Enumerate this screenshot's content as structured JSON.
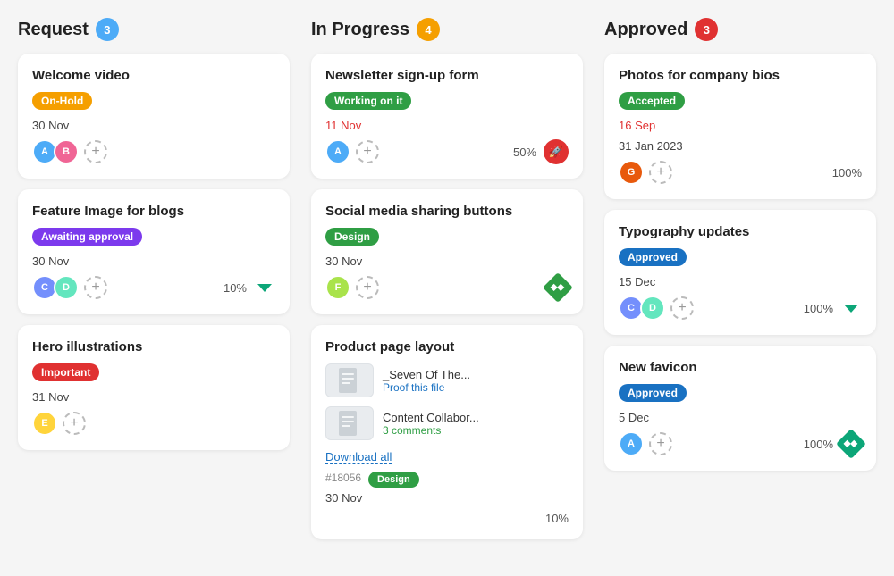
{
  "columns": [
    {
      "id": "request",
      "title": "Request",
      "badge": "3",
      "badge_color": "badge-blue",
      "cards": [
        {
          "id": "welcome-video",
          "title": "Welcome video",
          "tag": "On-Hold",
          "tag_color": "tag-orange",
          "date": "30 Nov",
          "date_red": false,
          "avatars": [
            "av1",
            "av2"
          ],
          "show_add": true,
          "percent": null,
          "icon": null
        },
        {
          "id": "feature-image",
          "title": "Feature Image for blogs",
          "tag": "Awaiting approval",
          "tag_color": "tag-purple",
          "date": "30 Nov",
          "date_red": false,
          "avatars": [
            "av3",
            "av4"
          ],
          "show_add": true,
          "percent": "10%",
          "icon": "chevron-down"
        },
        {
          "id": "hero-illustrations",
          "title": "Hero illustrations",
          "tag": "Important",
          "tag_color": "tag-red",
          "date": "31 Nov",
          "date_red": false,
          "avatars": [
            "av5"
          ],
          "show_add": true,
          "percent": null,
          "icon": null
        }
      ]
    },
    {
      "id": "in-progress",
      "title": "In Progress",
      "badge": "4",
      "badge_color": "badge-orange",
      "cards": [
        {
          "id": "newsletter-form",
          "title": "Newsletter sign-up form",
          "tag": "Working on it",
          "tag_color": "tag-working",
          "date": "11 Nov",
          "date_red": true,
          "avatars": [
            "av1"
          ],
          "show_add": true,
          "percent": "50%",
          "icon": "rocket",
          "type": "standard"
        },
        {
          "id": "social-media",
          "title": "Social media sharing buttons",
          "tag": "Design",
          "tag_color": "tag-design",
          "date": "30 Nov",
          "date_red": false,
          "avatars": [
            "av6"
          ],
          "show_add": true,
          "percent": null,
          "icon": "diamond-green",
          "type": "standard"
        },
        {
          "id": "product-page",
          "title": "Product page layout",
          "tag": null,
          "tag_color": null,
          "date": "30 Nov",
          "date_red": false,
          "avatars": [],
          "show_add": false,
          "percent": "10%",
          "icon": null,
          "type": "files",
          "files": [
            {
              "name": "_Seven Of The...",
              "link": "Proof this file",
              "link_color": "file-link"
            },
            {
              "name": "Content Collabor...",
              "link": "3 comments",
              "link_color": "file-link-green"
            }
          ],
          "download": "Download all",
          "ticket": "#18056",
          "ticket_tag": "Design"
        }
      ]
    },
    {
      "id": "approved",
      "title": "Approved",
      "badge": "3",
      "badge_color": "badge-red",
      "cards": [
        {
          "id": "photos-bios",
          "title": "Photos for company bios",
          "tag": "Accepted",
          "tag_color": "tag-green",
          "date": "16 Sep",
          "date_red": true,
          "date2": "31 Jan 2023",
          "avatars": [
            "av7"
          ],
          "show_add": true,
          "percent": "100%",
          "icon": null
        },
        {
          "id": "typography",
          "title": "Typography updates",
          "tag": "Approved",
          "tag_color": "tag-blue",
          "date": "15 Dec",
          "date_red": false,
          "avatars": [
            "av3",
            "av4"
          ],
          "show_add": true,
          "percent": "100%",
          "icon": "chevron-down"
        },
        {
          "id": "new-favicon",
          "title": "New favicon",
          "tag": "Approved",
          "tag_color": "tag-blue",
          "date": "5 Dec",
          "date_red": false,
          "avatars": [
            "av1"
          ],
          "show_add": true,
          "percent": "100%",
          "icon": "diamond-teal"
        }
      ]
    }
  ],
  "labels": {
    "add": "+",
    "proof_this": "Proof this file",
    "comments": "3 comments",
    "download_all": "Download all"
  }
}
